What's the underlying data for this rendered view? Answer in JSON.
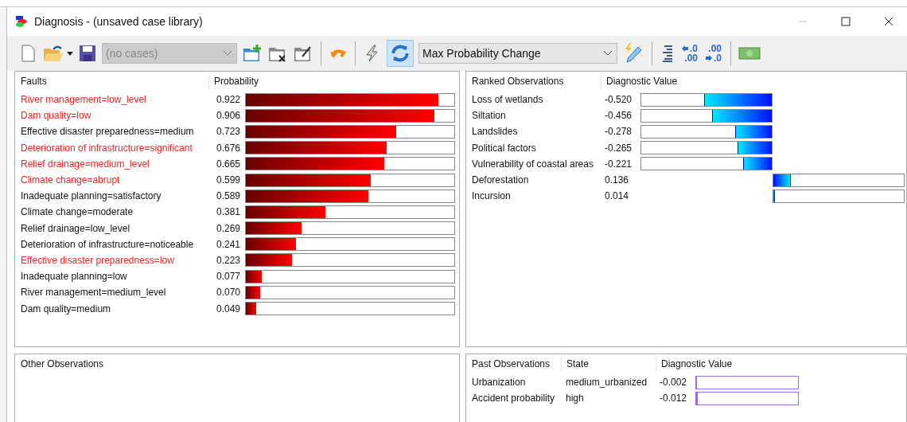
{
  "window": {
    "title": "Diagnosis - (unsaved case library)"
  },
  "toolbar": {
    "case_combo": {
      "value": "(no cases)",
      "disabled": true
    },
    "refresh_pressed": true,
    "measure_combo": {
      "value": "Max Probability Change",
      "disabled": false
    },
    "decimal_buttons": [
      {
        "kind": "decrease",
        "top": ".0",
        "bottom": ".00"
      },
      {
        "kind": "increase",
        "top": ".00",
        "bottom": ".0"
      }
    ]
  },
  "faults": {
    "columns": [
      "Faults",
      "Probability"
    ],
    "rows": [
      {
        "name": "River management=low_level",
        "value": "0.922",
        "level": 0.922,
        "highlighted": true
      },
      {
        "name": "Dam quality=low",
        "value": "0.906",
        "level": 0.906,
        "highlighted": true
      },
      {
        "name": "Effective disaster preparedness=medium",
        "value": "0.723",
        "level": 0.723,
        "highlighted": false
      },
      {
        "name": "Deterioration of infrastructure=significant",
        "value": "0.676",
        "level": 0.676,
        "highlighted": true
      },
      {
        "name": "Relief drainage=medium_level",
        "value": "0.665",
        "level": 0.665,
        "highlighted": true
      },
      {
        "name": "Climate change=abrupt",
        "value": "0.599",
        "level": 0.599,
        "highlighted": true
      },
      {
        "name": "Inadequate planning=satisfactory",
        "value": "0.589",
        "level": 0.589,
        "highlighted": false
      },
      {
        "name": "Climate change=moderate",
        "value": "0.381",
        "level": 0.381,
        "highlighted": false
      },
      {
        "name": "Relief drainage=low_level",
        "value": "0.269",
        "level": 0.269,
        "highlighted": false
      },
      {
        "name": "Deterioration of infrastructure=noticeable",
        "value": "0.241",
        "level": 0.241,
        "highlighted": false
      },
      {
        "name": "Effective disaster preparedness=low",
        "value": "0.223",
        "level": 0.223,
        "highlighted": true
      },
      {
        "name": "Inadequate planning=low",
        "value": "0.077",
        "level": 0.077,
        "highlighted": false
      },
      {
        "name": "River management=medium_level",
        "value": "0.070",
        "level": 0.07,
        "highlighted": false
      },
      {
        "name": "Dam quality=medium",
        "value": "0.049",
        "level": 0.049,
        "highlighted": false
      }
    ]
  },
  "ranked_observations": {
    "columns": [
      "Ranked Observations",
      "Diagnostic Value"
    ],
    "rows": [
      {
        "name": "Loss of wetlands",
        "value": "-0.520",
        "kind": "negative",
        "level": 0.52
      },
      {
        "name": "Siltation",
        "value": "-0.456",
        "kind": "negative",
        "level": 0.456
      },
      {
        "name": "Landslides",
        "value": "-0.278",
        "kind": "negative",
        "level": 0.278
      },
      {
        "name": "Political factors",
        "value": "-0.265",
        "kind": "negative",
        "level": 0.265
      },
      {
        "name": "Vulnerability of coastal areas",
        "value": "-0.221",
        "kind": "negative",
        "level": 0.221
      },
      {
        "name": "Deforestation",
        "value": "0.136",
        "kind": "positive",
        "level": 0.136
      },
      {
        "name": "Incursion",
        "value": "0.014",
        "kind": "positive",
        "level": 0.014
      }
    ]
  },
  "other_observations": {
    "title": "Other Observations"
  },
  "past_observations": {
    "columns": [
      "Past Observations",
      "State",
      "Diagnostic Value"
    ],
    "rows": [
      {
        "name": "Urbanization",
        "state": "medium_urbanized",
        "value": "-0.002",
        "level": 0.002
      },
      {
        "name": "Accident probability",
        "state": "high",
        "value": "-0.012",
        "level": 0.012
      }
    ]
  }
}
